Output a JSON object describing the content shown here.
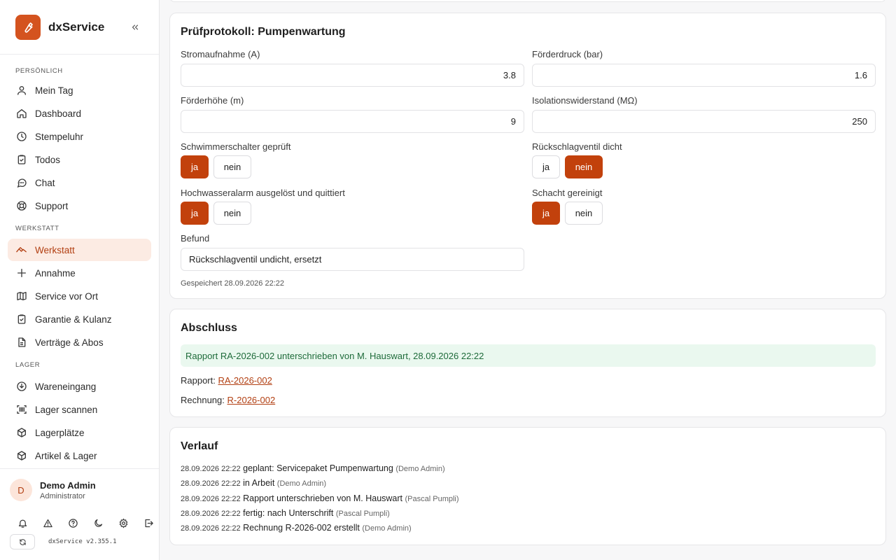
{
  "app": {
    "name": "dxService",
    "version": "dxService v2.355.1"
  },
  "sidebar": {
    "sections": [
      {
        "label": "PERSÖNLICH",
        "items": [
          {
            "label": "Mein Tag",
            "icon": "user-icon"
          },
          {
            "label": "Dashboard",
            "icon": "home-icon"
          },
          {
            "label": "Stempeluhr",
            "icon": "clock-icon"
          },
          {
            "label": "Todos",
            "icon": "clipboard-check-icon"
          },
          {
            "label": "Chat",
            "icon": "chat-icon"
          },
          {
            "label": "Support",
            "icon": "lifebuoy-icon"
          }
        ]
      },
      {
        "label": "WERKSTATT",
        "items": [
          {
            "label": "Werkstatt",
            "icon": "wrench-icon",
            "active": true
          },
          {
            "label": "Annahme",
            "icon": "plus-icon"
          },
          {
            "label": "Service vor Ort",
            "icon": "map-icon"
          },
          {
            "label": "Garantie & Kulanz",
            "icon": "clipboard-check-icon"
          },
          {
            "label": "Verträge & Abos",
            "icon": "document-icon"
          }
        ]
      },
      {
        "label": "LAGER",
        "items": [
          {
            "label": "Wareneingang",
            "icon": "download-icon"
          },
          {
            "label": "Lager scannen",
            "icon": "barcode-icon"
          },
          {
            "label": "Lagerplätze",
            "icon": "box-icon"
          },
          {
            "label": "Artikel & Lager",
            "icon": "box-icon"
          }
        ]
      }
    ],
    "user": {
      "initial": "D",
      "name": "Demo Admin",
      "role": "Administrator"
    }
  },
  "protocol": {
    "title": "Prüfprotokoll: Pumpenwartung",
    "fields": {
      "strom": {
        "label": "Stromaufnahme (A)",
        "value": "3.8"
      },
      "druck": {
        "label": "Förderdruck (bar)",
        "value": "1.6"
      },
      "hoehe": {
        "label": "Förderhöhe (m)",
        "value": "9"
      },
      "iso": {
        "label": "Isolationswiderstand (MΩ)",
        "value": "250"
      }
    },
    "toggles": {
      "schwimmer": {
        "label": "Schwimmerschalter geprüft",
        "yes": "ja",
        "no": "nein",
        "selected": "ja"
      },
      "rueck": {
        "label": "Rückschlagventil dicht",
        "yes": "ja",
        "no": "nein",
        "selected": "nein"
      },
      "hochwasser": {
        "label": "Hochwasseralarm ausgelöst und quittiert",
        "yes": "ja",
        "no": "nein",
        "selected": "ja"
      },
      "schacht": {
        "label": "Schacht gereinigt",
        "yes": "ja",
        "no": "nein",
        "selected": "ja"
      }
    },
    "befund": {
      "label": "Befund",
      "value": "Rückschlagventil undicht, ersetzt"
    },
    "saved": "Gespeichert 28.09.2026 22:22"
  },
  "abschluss": {
    "title": "Abschluss",
    "notice": "Rapport RA-2026-002 unterschrieben von M. Hauswart, 28.09.2026 22:22",
    "rapport_label": "Rapport:",
    "rapport_link": "RA-2026-002",
    "rechnung_label": "Rechnung:",
    "rechnung_link": "R-2026-002"
  },
  "verlauf": {
    "title": "Verlauf",
    "entries": [
      {
        "ts": "28.09.2026 22:22",
        "text": "geplant: Servicepaket Pumpenwartung",
        "who": "(Demo Admin)"
      },
      {
        "ts": "28.09.2026 22:22",
        "text": "in Arbeit",
        "who": "(Demo Admin)"
      },
      {
        "ts": "28.09.2026 22:22",
        "text": "Rapport unterschrieben von M. Hauswart",
        "who": "(Pascal Pumpli)"
      },
      {
        "ts": "28.09.2026 22:22",
        "text": "fertig: nach Unterschrift",
        "who": "(Pascal Pumpli)"
      },
      {
        "ts": "28.09.2026 22:22",
        "text": "Rechnung R-2026-002 erstellt",
        "who": "(Demo Admin)"
      }
    ]
  },
  "colors": {
    "accent": "#c2410c",
    "accent_soft": "#fcebe3",
    "success_bg": "#eaf8ef",
    "success_text": "#1e6b3a"
  }
}
